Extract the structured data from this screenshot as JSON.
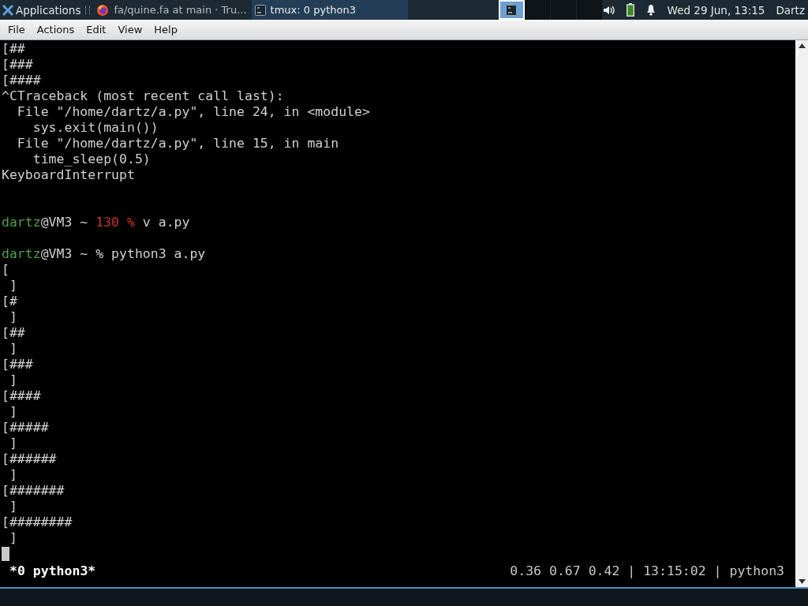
{
  "taskbar": {
    "apps_menu": "Applications",
    "tasks": [
      {
        "title": "fa/quine.fa at main · Tru...",
        "selected": false,
        "kind": "browser"
      },
      {
        "title": "tmux: 0 python3",
        "selected": true,
        "kind": "terminal"
      }
    ],
    "workspaces": [
      {
        "selected": true,
        "kind": "terminal"
      },
      {
        "selected": false,
        "kind": "empty"
      },
      {
        "selected": false,
        "kind": "empty"
      },
      {
        "selected": false,
        "kind": "empty"
      }
    ],
    "clock": "Wed 29 Jun, 13:15",
    "user": "Dartz"
  },
  "menu_bar": [
    "File",
    "Actions",
    "Edit",
    "View",
    "Help"
  ],
  "terminal": {
    "lines": [
      {
        "kind": "text",
        "text": "[##"
      },
      {
        "kind": "text",
        "text": "[###"
      },
      {
        "kind": "text",
        "text": "[####"
      },
      {
        "kind": "text",
        "text": "^CTraceback (most recent call last):"
      },
      {
        "kind": "text",
        "text": "  File \"/home/dartz/a.py\", line 24, in <module>"
      },
      {
        "kind": "text",
        "text": "    sys.exit(main())"
      },
      {
        "kind": "text",
        "text": "  File \"/home/dartz/a.py\", line 15, in main"
      },
      {
        "kind": "text",
        "text": "    time_sleep(0.5)"
      },
      {
        "kind": "text",
        "text": "KeyboardInterrupt"
      },
      {
        "kind": "blank"
      },
      {
        "kind": "blank"
      },
      {
        "kind": "prompt",
        "segments": [
          {
            "text": "dartz",
            "kind": "user"
          },
          {
            "text": "@VM3 ~ ",
            "kind": "plain"
          },
          {
            "text": "130 %",
            "kind": "error"
          },
          {
            "text": " v a.py",
            "kind": "plain"
          }
        ]
      },
      {
        "kind": "blank"
      },
      {
        "kind": "prompt",
        "segments": [
          {
            "text": "dartz",
            "kind": "user"
          },
          {
            "text": "@VM3 ~ % python3 a.py",
            "kind": "plain"
          }
        ]
      },
      {
        "kind": "text",
        "text": "["
      },
      {
        "kind": "text",
        "text": " ]"
      },
      {
        "kind": "text",
        "text": "[#"
      },
      {
        "kind": "text",
        "text": " ]"
      },
      {
        "kind": "text",
        "text": "[##"
      },
      {
        "kind": "text",
        "text": " ]"
      },
      {
        "kind": "text",
        "text": "[###"
      },
      {
        "kind": "text",
        "text": " ]"
      },
      {
        "kind": "text",
        "text": "[####"
      },
      {
        "kind": "text",
        "text": " ]"
      },
      {
        "kind": "text",
        "text": "[#####"
      },
      {
        "kind": "text",
        "text": " ]"
      },
      {
        "kind": "text",
        "text": "[######"
      },
      {
        "kind": "text",
        "text": " ]"
      },
      {
        "kind": "text",
        "text": "[#######"
      },
      {
        "kind": "text",
        "text": " ]"
      },
      {
        "kind": "text",
        "text": "[########"
      },
      {
        "kind": "text",
        "text": " ]"
      },
      {
        "kind": "cursor"
      }
    ]
  },
  "status_bar": {
    "window": "*0 python3*",
    "info": "0.36 0.67 0.42 | 13:15:02 | python3"
  }
}
